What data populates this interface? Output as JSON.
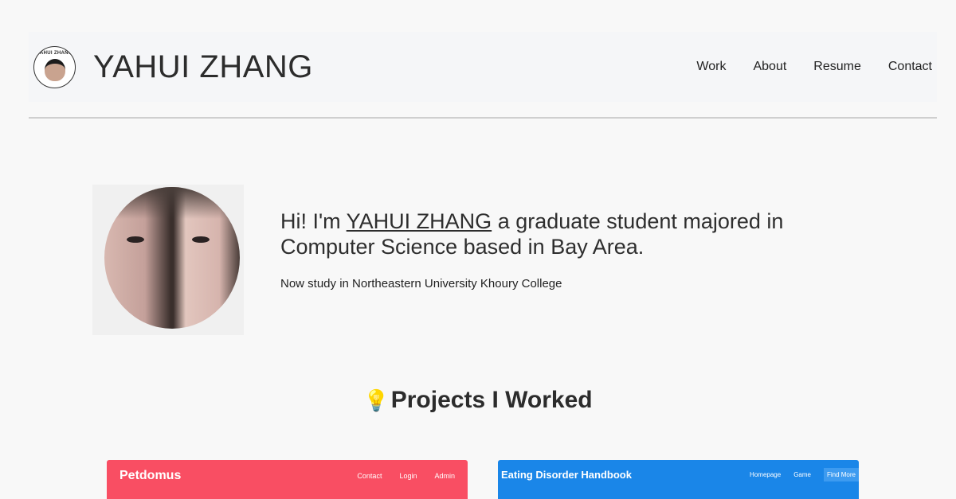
{
  "header": {
    "logo_text": "YAHUI ZHANG",
    "title": "YAHUI ZHANG",
    "nav": [
      "Work",
      "About",
      "Resume",
      "Contact"
    ]
  },
  "hero": {
    "greeting_prefix": "Hi! I'm ",
    "name": "YAHUI ZHANG",
    "greeting_suffix": " a graduate student majored in Computer Science based in Bay Area.",
    "subtitle": "Now study in Northeastern University Khoury College"
  },
  "projects": {
    "icon": "lightbulb-icon",
    "title": "Projects I Worked",
    "cards": [
      {
        "title": "Petdomus",
        "color": "#f94e63",
        "nav": [
          "Contact",
          "Login",
          "Admin"
        ]
      },
      {
        "title": "Eating Disorder Handbook",
        "color": "#1a86e8",
        "nav": [
          "Homepage",
          "Game",
          "Find More"
        ]
      }
    ]
  }
}
